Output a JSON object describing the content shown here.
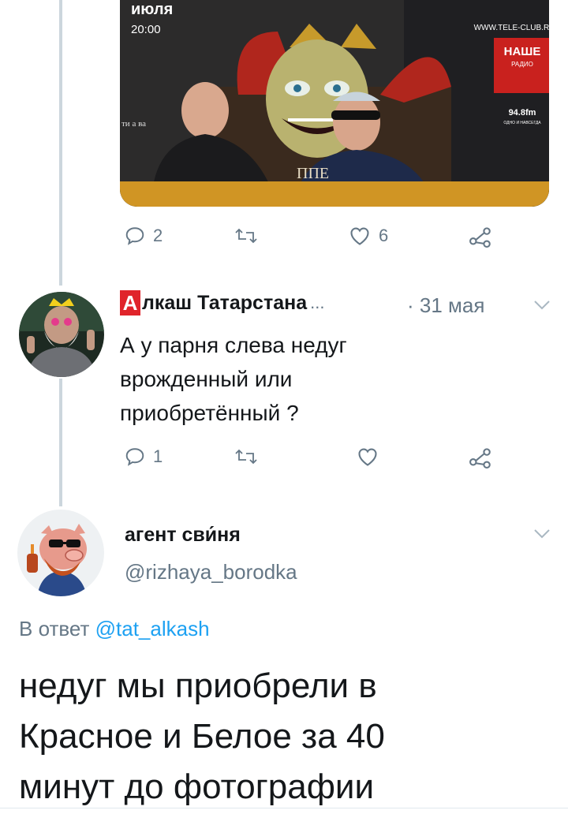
{
  "tweet1": {
    "photo_text": {
      "month": "июля",
      "time": "20:00",
      "site": "WWW.TELE-CLUB.RU",
      "radio_name": "НАШЕ",
      "radio_sub": "РАДИО",
      "radio_freq": "94.8fm",
      "radio_tag": "ОДНО И НАВСЕГДА",
      "side_text": "ти а ва",
      "bottom_text": "ППЕ"
    },
    "reply_count": "2",
    "like_count": "6"
  },
  "tweet2": {
    "badge": "А",
    "name": "лкаш Татарстана",
    "ellipsis": "...",
    "date": "· 31 мая",
    "lines": [
      "А у парня слева недуг",
      "врожденный или",
      "приобретённый ?"
    ],
    "reply_count": "1"
  },
  "tweet3": {
    "name": "агент сви́ня",
    "handle": "@rizhaya_borodka",
    "reply_to_prefix": "В ответ ",
    "reply_to_handle": "@tat_alkash",
    "lines": [
      "недуг мы приобрели в",
      "Красное и Белое за 40",
      "минут до фотографии"
    ]
  },
  "icons": {
    "reply": "reply-icon",
    "retweet": "retweet-icon",
    "like": "heart-icon",
    "share": "share-icon",
    "more": "chevron-down-icon"
  },
  "colors": {
    "text": "#14171a",
    "secondary": "#657786",
    "link": "#1da1f2",
    "thread": "#ccd6dd",
    "badge": "#e0242b"
  }
}
